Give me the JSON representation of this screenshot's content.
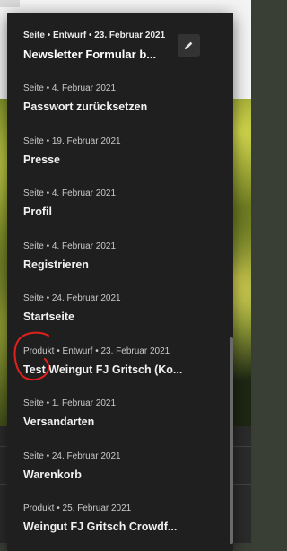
{
  "items": [
    {
      "meta": "Seite • Entwurf • 23. Februar 2021",
      "title": "Newsletter Formular b..."
    },
    {
      "meta": "Seite • 4. Februar 2021",
      "title": "Passwort zurücksetzen"
    },
    {
      "meta": "Seite • 19. Februar 2021",
      "title": "Presse"
    },
    {
      "meta": "Seite • 4. Februar 2021",
      "title": "Profil"
    },
    {
      "meta": "Seite • 4. Februar 2021",
      "title": "Registrieren"
    },
    {
      "meta": "Seite • 24. Februar 2021",
      "title": "Startseite"
    },
    {
      "meta": "Produkt • Entwurf • 23. Februar 2021",
      "title": "Test Weingut FJ Gritsch (Ko..."
    },
    {
      "meta": "Seite • 1. Februar 2021",
      "title": "Versandarten"
    },
    {
      "meta": "Seite • 24. Februar 2021",
      "title": "Warenkorb"
    },
    {
      "meta": "Produkt • 25. Februar 2021",
      "title": "Weingut FJ Gritsch Crowdf..."
    }
  ],
  "icons": {
    "edit": "pencil-icon"
  },
  "colors": {
    "panel_bg": "#1f1f1f",
    "annotation": "#e0201c"
  }
}
